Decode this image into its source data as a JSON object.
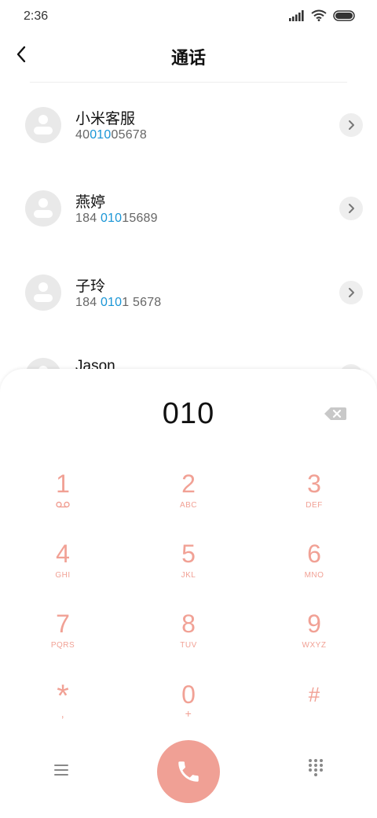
{
  "status_bar": {
    "time": "2:36"
  },
  "header": {
    "title": "通话"
  },
  "contacts": [
    {
      "name": "小米客服",
      "number_pre": "40",
      "number_match": "010",
      "number_post": "05678"
    },
    {
      "name": "燕婷",
      "number_pre": "184 ",
      "number_match": "010",
      "number_post": "15689"
    },
    {
      "name": "子玲",
      "number_pre": "184 ",
      "number_match": "010",
      "number_post": "1 5678"
    },
    {
      "name": "Jason",
      "number_pre": "",
      "number_match": "",
      "number_post": ""
    }
  ],
  "dialpad": {
    "number": "010",
    "keys": [
      {
        "digit": "1",
        "letters": ""
      },
      {
        "digit": "2",
        "letters": "ABC"
      },
      {
        "digit": "3",
        "letters": "DEF"
      },
      {
        "digit": "4",
        "letters": "GHI"
      },
      {
        "digit": "5",
        "letters": "JKL"
      },
      {
        "digit": "6",
        "letters": "MNO"
      },
      {
        "digit": "7",
        "letters": "PQRS"
      },
      {
        "digit": "8",
        "letters": "TUV"
      },
      {
        "digit": "9",
        "letters": "WXYZ"
      },
      {
        "digit": "*",
        "letters": ","
      },
      {
        "digit": "0",
        "letters": "+"
      },
      {
        "digit": "#",
        "letters": ""
      }
    ]
  },
  "colors": {
    "accent_pink": "#f1a195",
    "call_button": "#f0a095",
    "match_highlight": "#1a96d6"
  },
  "icons": {
    "back": "chevron-left-icon",
    "voicemail": "voicemail-icon",
    "backspace": "backspace-icon",
    "call": "phone-icon",
    "menu": "menu-icon",
    "keypad": "dialpad-grid-icon"
  }
}
